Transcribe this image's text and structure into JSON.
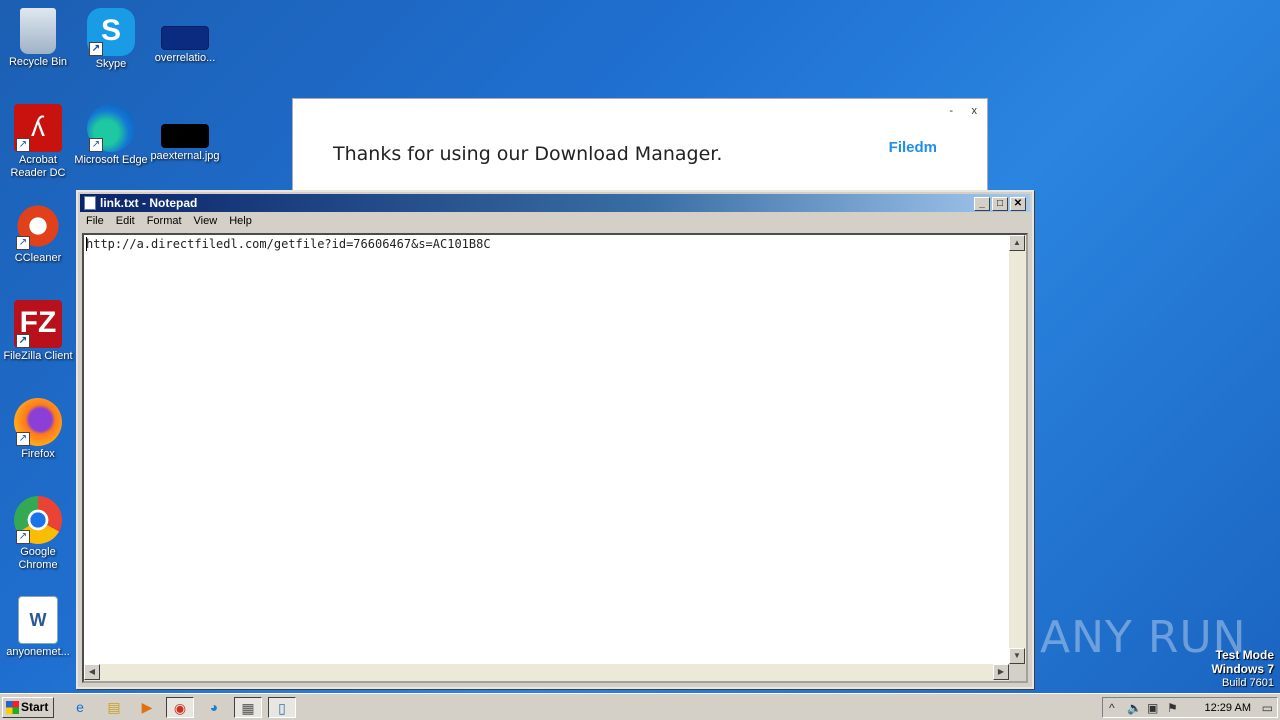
{
  "desktop": {
    "icons": [
      {
        "label": "Recycle Bin"
      },
      {
        "label": "Skype"
      },
      {
        "label": "overrelatio..."
      },
      {
        "label": "Acrobat Reader DC"
      },
      {
        "label": "Microsoft Edge"
      },
      {
        "label": "paexternal.jpg"
      },
      {
        "label": "CCleaner"
      },
      {
        "label": "FileZilla Client"
      },
      {
        "label": "Firefox"
      },
      {
        "label": "Google Chrome"
      },
      {
        "label": "anyonemet..."
      }
    ]
  },
  "popup": {
    "message": "Thanks for using our Download Manager.",
    "brand": "Filedm",
    "minimize": "-",
    "close": "x"
  },
  "notepad": {
    "title": "link.txt - Notepad",
    "menu": [
      "File",
      "Edit",
      "Format",
      "View",
      "Help"
    ],
    "content": "http://a.directfiledl.com/getfile?id=76606467&s=AC101B8C"
  },
  "watermark": {
    "text": "ANY RUN",
    "mode": "Test Mode",
    "os": "Windows 7",
    "build": "Build 7601"
  },
  "taskbar": {
    "start": "Start",
    "clock": "12:29 AM"
  }
}
